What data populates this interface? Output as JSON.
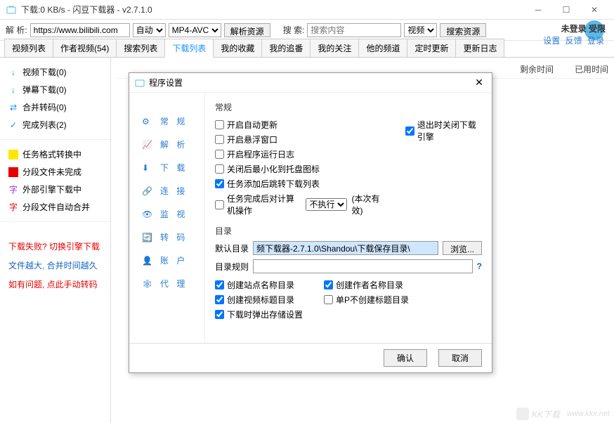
{
  "window": {
    "title": "下载:0 KB/s - 闪豆下载器 - v2.7.1.0"
  },
  "toolbar": {
    "parse_label": "解 析:",
    "url_value": "https://www.bilibili.com",
    "auto_label": "自动",
    "codec_label": "MP4-AVC",
    "parse_btn": "解析资源",
    "search_label": "搜 索:",
    "search_placeholder": "搜索内容",
    "search_type": "视频",
    "search_btn": "搜索资源"
  },
  "topright": {
    "status": "未登录  受限",
    "links": {
      "settings": "设置",
      "feedback": "反馈",
      "login": "登录"
    }
  },
  "tabs": [
    "视频列表",
    "作者视频(54)",
    "搜索列表",
    "下载列表",
    "我的收藏",
    "我的追番",
    "我的关注",
    "他的频道",
    "定时更新",
    "更新日志"
  ],
  "activeTab": 3,
  "sidebar": {
    "groups": [
      {
        "icon": "↓",
        "label": "视频下载(0)"
      },
      {
        "icon": "↓",
        "label": "弹幕下载(0)"
      },
      {
        "icon": "⇄",
        "label": "合并转码(0)"
      },
      {
        "icon": "✓",
        "label": "完成列表(2)"
      }
    ],
    "legend": [
      {
        "color": "#ffe600",
        "label": "任务格式转换中"
      },
      {
        "color": "#e60000",
        "label": "分段文件未完成"
      },
      {
        "color": "#9b2fcf",
        "text": "字",
        "label": "外部引擎下载中"
      },
      {
        "color": "#e60000",
        "text": "字",
        "label": "分段文件自动合并"
      }
    ],
    "notes": {
      "a": "下载失败? 切换引擎下载",
      "b": "文件越大, 合并时间越久",
      "c": "如有问题, 点此手动转码"
    }
  },
  "content_cols": {
    "remain": "剩余时间",
    "elapsed": "已用时间"
  },
  "modal": {
    "title": "程序设置",
    "nav": [
      "常 规",
      "解 析",
      "下 载",
      "连 接",
      "监 视",
      "转 码",
      "账 户",
      "代 理"
    ],
    "nav_icons": [
      "gear",
      "chart",
      "download",
      "link",
      "eye",
      "refresh",
      "user",
      "network"
    ],
    "general": {
      "heading": "常规",
      "chk_auto_update": "开启自动更新",
      "chk_exit_close": "退出时关闭下载引擎",
      "chk_float": "开启悬浮窗口",
      "chk_runlog": "开启程序运行日志",
      "chk_min_tray": "关闭后最小化到托盘图标",
      "chk_jump_list": "任务添加后跳转下载列表",
      "chk_post_action": "任务完成后对计算机操作",
      "post_sel": "不执行",
      "post_note": "(本次有效)"
    },
    "dir": {
      "heading": "目录",
      "default_label": "默认目录",
      "default_value": "频下载器-2.7.1.0\\Shandou\\下载保存目录\\",
      "browse": "浏览...",
      "rule_label": "目录规则",
      "rule_value": "",
      "chk_site_dir": "创建站点名称目录",
      "chk_author_dir": "创建作者名称目录",
      "chk_title_dir": "创建视频标题目录",
      "chk_single_p": "单P不创建标题目录",
      "chk_popup": "下载时弹出存储设置"
    },
    "footer": {
      "ok": "确认",
      "cancel": "取消"
    }
  },
  "watermark": {
    "text": "KK下载",
    "url": "www.kkx.net"
  }
}
